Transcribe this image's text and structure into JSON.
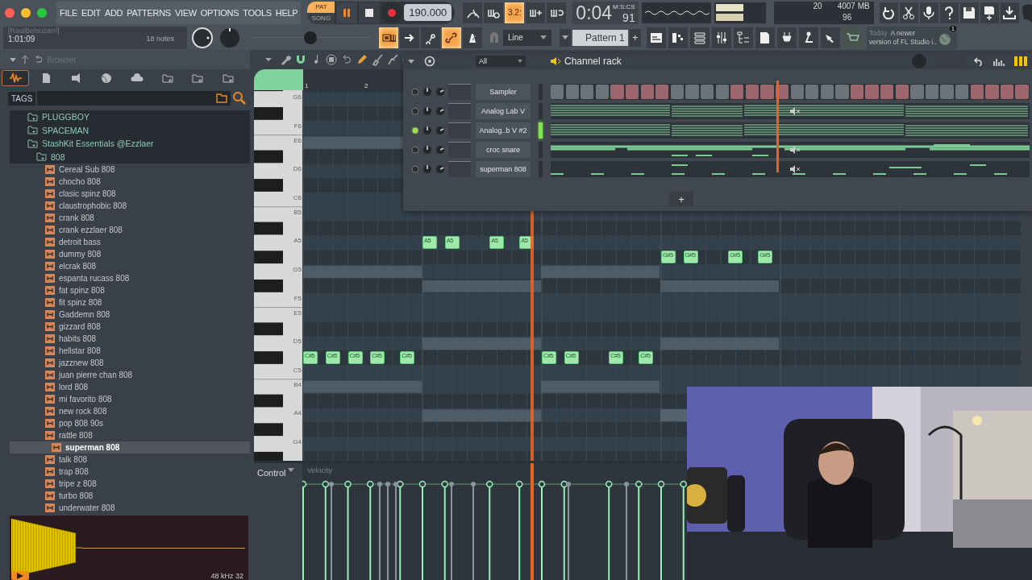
{
  "menu": [
    "FILE",
    "EDIT",
    "ADD",
    "PATTERNS",
    "VIEW",
    "OPTIONS",
    "TOOLS",
    "HELP"
  ],
  "hint": {
    "title": "[RaulBelsuzarri]",
    "value": "1:01:09",
    "notes": "18 notes"
  },
  "modes": [
    {
      "label": "PAT",
      "selected": true
    },
    {
      "label": "SONG",
      "selected": false
    }
  ],
  "playing": true,
  "tempo": "190.000",
  "toggles_top": [
    {
      "kind": "pitch",
      "on": false
    },
    {
      "kind": "tap",
      "on": false
    },
    {
      "kind": "count",
      "label": "3.2:",
      "on": true
    },
    {
      "kind": "blend",
      "on": false
    },
    {
      "kind": "loop",
      "on": false
    }
  ],
  "clock": {
    "time": "0:04",
    "fraction": "91",
    "format": "M:S:CS"
  },
  "monitor": {
    "cpu": "20",
    "memory": "4007 MB",
    "voices": "96"
  },
  "master_pitch": {
    "level": 0.5
  },
  "toggles_bottom": [
    {
      "kind": "typing",
      "on": true
    },
    {
      "kind": "arrow",
      "on": false
    },
    {
      "kind": "step",
      "on": false
    },
    {
      "kind": "link",
      "on": true
    },
    {
      "kind": "metronome",
      "on": false
    }
  ],
  "snap": "Line",
  "pattern": {
    "name": "Pattern 1",
    "add": "+"
  },
  "news": {
    "when": "Today",
    "text": "A newer",
    "text_2": "version of FL Studio i..",
    "badge": "1"
  },
  "browser": {
    "title": "Browser",
    "tags_label": "TAGS",
    "tabs": [
      {
        "kind": "all",
        "selected": true
      },
      {
        "kind": "file",
        "selected": false
      },
      {
        "kind": "plugin",
        "selected": false
      },
      {
        "kind": "web",
        "selected": false
      },
      {
        "kind": "cloud",
        "selected": false
      },
      {
        "kind": "folder",
        "selected": false
      },
      {
        "kind": "folder",
        "selected": false
      },
      {
        "kind": "folder",
        "selected": false
      }
    ],
    "tree": [
      {
        "label": "PLUGGBOY",
        "kind": "folder",
        "selected": false
      },
      {
        "label": "SPACEMAN",
        "kind": "folder",
        "selected": false
      },
      {
        "label": "StashKit Essentials @Ezzlaer",
        "kind": "folder",
        "selected": false,
        "children": [
          {
            "label": "808",
            "kind": "folder",
            "selected": false,
            "children": [
              {
                "label": "Cereal Sub 808",
                "kind": "file",
                "selected": false
              },
              {
                "label": "chocho 808",
                "kind": "file",
                "selected": false
              },
              {
                "label": "clasic spinz 808",
                "kind": "file",
                "selected": false
              },
              {
                "label": "claustrophobic 808",
                "kind": "file",
                "selected": false
              },
              {
                "label": "crank 808",
                "kind": "file",
                "selected": false
              },
              {
                "label": "crank ezzlaer 808",
                "kind": "file",
                "selected": false
              },
              {
                "label": "detroit bass",
                "kind": "file",
                "selected": false
              },
              {
                "label": "dummy 808",
                "kind": "file",
                "selected": false
              },
              {
                "label": "elcrak 808",
                "kind": "file",
                "selected": false
              },
              {
                "label": "espanta rucass 808",
                "kind": "file",
                "selected": false
              },
              {
                "label": "fat spinz 808",
                "kind": "file",
                "selected": false
              },
              {
                "label": "fit spinz 808",
                "kind": "file",
                "selected": false
              },
              {
                "label": "Gaddemn 808",
                "kind": "file",
                "selected": false
              },
              {
                "label": "gizzard 808",
                "kind": "file",
                "selected": false
              },
              {
                "label": "habits 808",
                "kind": "file",
                "selected": false
              },
              {
                "label": "hellstar 808",
                "kind": "file",
                "selected": false
              },
              {
                "label": "jazznew 808",
                "kind": "file",
                "selected": false
              },
              {
                "label": "juan pierre chan 808",
                "kind": "file",
                "selected": false
              },
              {
                "label": "lord 808",
                "kind": "file",
                "selected": false
              },
              {
                "label": "mi favorito 808",
                "kind": "file",
                "selected": false
              },
              {
                "label": "new rock 808",
                "kind": "file",
                "selected": false
              },
              {
                "label": "pop 808 90s",
                "kind": "file",
                "selected": false
              },
              {
                "label": "rattle 808",
                "kind": "file",
                "selected": false
              },
              {
                "label": "superman 808",
                "kind": "file",
                "selected": true
              },
              {
                "label": "talk 808",
                "kind": "file",
                "selected": false
              },
              {
                "label": "trap 808",
                "kind": "file",
                "selected": false
              },
              {
                "label": "tripe z 808",
                "kind": "file",
                "selected": false
              },
              {
                "label": "turbo 808",
                "kind": "file",
                "selected": false
              },
              {
                "label": "underwater 808",
                "kind": "file",
                "selected": false
              }
            ]
          }
        ]
      }
    ],
    "preview": {
      "info": "48 kHz 32"
    }
  },
  "piano_roll": {
    "ruler": [
      "1",
      "2"
    ],
    "keys": [
      "G6",
      "F6",
      "E6",
      "D6",
      "C6",
      "B5",
      "A5",
      "G5",
      "F5",
      "E5",
      "D5",
      "C5",
      "B4",
      "A4",
      "G4"
    ],
    "notes": [
      {
        "label": "C#5"
      },
      {
        "label": "C#5"
      },
      {
        "label": "C#5"
      },
      {
        "label": "C#5"
      },
      {
        "label": "C#5"
      },
      {
        "label": "A5"
      },
      {
        "label": "A5"
      },
      {
        "label": "A5"
      },
      {
        "label": "A5"
      },
      {
        "label": "C#5"
      },
      {
        "label": "C#5"
      },
      {
        "label": "C#5"
      },
      {
        "label": "C#5"
      },
      {
        "label": "G#5"
      },
      {
        "label": "G#5"
      },
      {
        "label": "G#5"
      },
      {
        "label": "G#5"
      }
    ],
    "control": {
      "label": "Control",
      "parameter": "Velocity"
    }
  },
  "channel_rack": {
    "title": "Channel rack",
    "filter": "All",
    "add": "+",
    "channels": [
      {
        "name": "Sampler",
        "kind": "steps",
        "selected": false,
        "steps": [
          false,
          false,
          false,
          false,
          false,
          false,
          false,
          false,
          false,
          false,
          false,
          false,
          false,
          false,
          false,
          false,
          false,
          false,
          false,
          false,
          false,
          false,
          false,
          false,
          false,
          false,
          false,
          false,
          false,
          false,
          false,
          false
        ]
      },
      {
        "name": "Analog Lab V",
        "kind": "chords",
        "selected": false,
        "mute_marker": true
      },
      {
        "name": "Analog..b V #2",
        "kind": "chords",
        "selected": true,
        "mute_marker": false
      },
      {
        "name": "croc snare",
        "kind": "hits",
        "selected": false,
        "mute_marker": true
      },
      {
        "name": "superman 808",
        "kind": "bass",
        "selected": false,
        "mute_marker": true
      }
    ]
  }
}
